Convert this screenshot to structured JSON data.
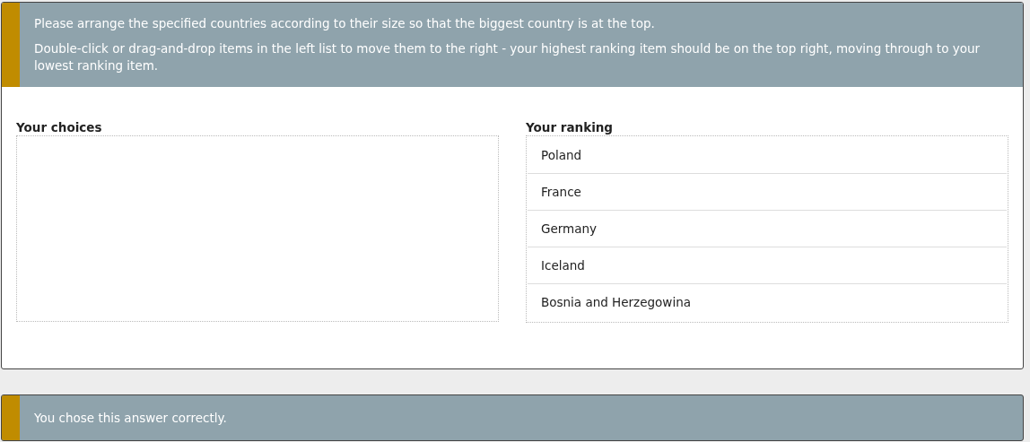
{
  "question": {
    "instructions": [
      "Please arrange the specified countries according to their size so that the biggest country is at the top.",
      "Double-click or drag-and-drop items in the left list to move them to the right - your highest ranking item should be on the top right, moving through to your lowest ranking item."
    ]
  },
  "choices": {
    "label": "Your choices"
  },
  "ranking": {
    "label": "Your ranking",
    "items": [
      "Poland",
      "France",
      "Germany",
      "Iceland",
      "Bosnia and Herzegowina"
    ]
  },
  "feedback": {
    "text": "You chose this answer correctly."
  }
}
